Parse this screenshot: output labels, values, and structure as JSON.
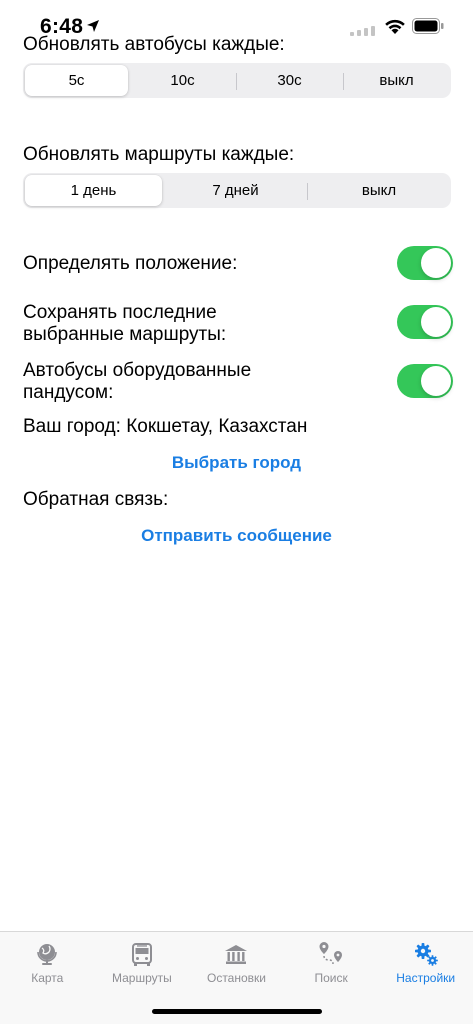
{
  "status_bar": {
    "time": "6:48"
  },
  "bus_refresh": {
    "label": "Обновлять автобусы каждые:",
    "options": [
      "5с",
      "10с",
      "30с",
      "выкл"
    ],
    "selected": "5с"
  },
  "route_refresh": {
    "label": "Обновлять маршруты каждые:",
    "options": [
      "1 день",
      "7 дней",
      "выкл"
    ],
    "selected": "1 день"
  },
  "toggles": {
    "location": {
      "label": "Определять положение:",
      "on": true
    },
    "save_routes": {
      "label": "Сохранять последние выбранные маршруты:",
      "on": true
    },
    "ramp_buses": {
      "label": "Автобусы оборудованные пандусом:",
      "on": true
    }
  },
  "city": {
    "text": "Ваш город: Кокшетау, Казахстан",
    "choose_button": "Выбрать город"
  },
  "feedback": {
    "label": "Обратная связь:",
    "send_button": "Отправить сообщение"
  },
  "tab_bar": {
    "tabs": [
      {
        "label": "Карта",
        "icon": "globe-icon"
      },
      {
        "label": "Маршруты",
        "icon": "bus-icon"
      },
      {
        "label": "Остановки",
        "icon": "building-columns-icon"
      },
      {
        "label": "Поиск",
        "icon": "route-pins-icon"
      },
      {
        "label": "Настройки",
        "icon": "gears-icon"
      }
    ],
    "active": "Настройки"
  },
  "colors": {
    "accent": "#1a7ee3",
    "toggle_on": "#34c759",
    "inactive_tab": "#8e8e93"
  }
}
